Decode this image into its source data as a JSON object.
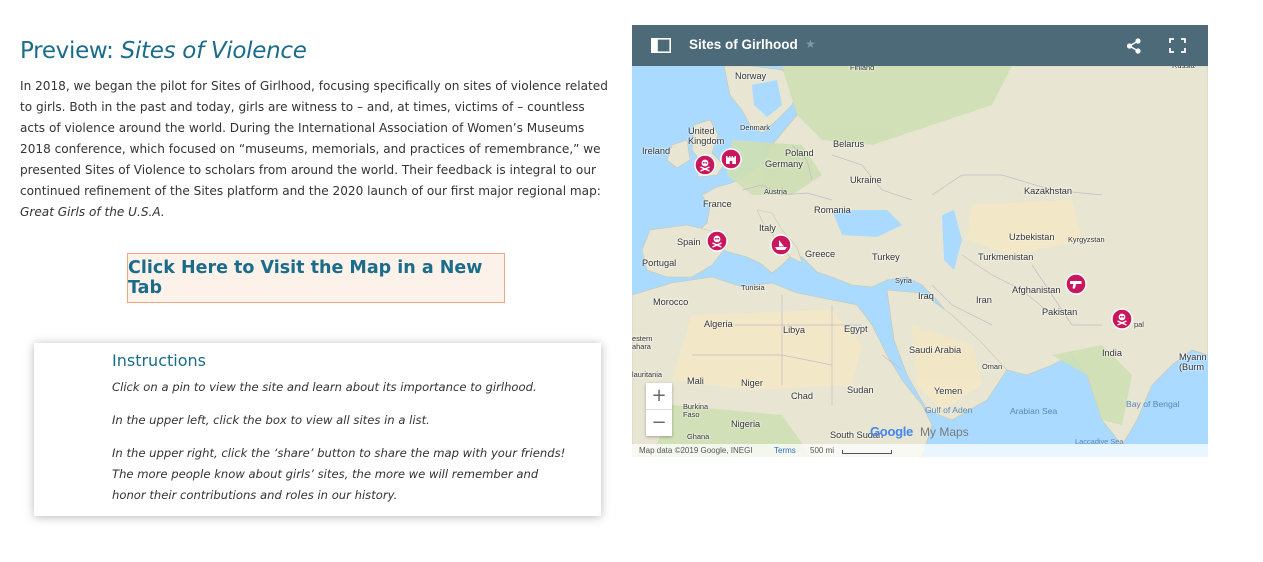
{
  "preview": {
    "title_prefix": "Preview: ",
    "title_em": "Sites of Violence",
    "intro_main": "In 2018, we began the pilot for Sites of Girlhood, focusing specifically on sites of violence related to girls. Both in the past and today, girls are witness to – and, at times, victims of – countless acts of violence around the world. During the International Association of Women’s Museums 2018 conference, which focused on “museums, memorials, and practices of remembrance,” we presented Sites of Violence to scholars from around the world. Their feedback is integral to our continued refinement of the Sites platform and the 2020 launch of our first major regional map: ",
    "intro_em": "Great Girls of the U.S.A."
  },
  "visit_button": "Click Here to Visit the Map in a New Tab",
  "instructions": {
    "heading": "Instructions",
    "items": [
      "Click on a pin to view the site and learn about its importance to girlhood.",
      "In the upper left, click the box to view all sites in a list.",
      "In the upper right, click the ‘share’ button to share the map with your friends! The more people know about girls’ sites, the more we will remember and honor their contributions and roles in our history."
    ]
  },
  "map": {
    "title": "Sites of Girlhood",
    "icons": {
      "list": "sidebar-list-icon",
      "star": "star-icon",
      "share": "share-icon",
      "fullscreen": "fullscreen-icon",
      "pin_colour": "#c8175d",
      "header_colour": "#4d6a78"
    },
    "labels": {
      "finland": "Finland",
      "norway": "Norway",
      "russia": "Russia",
      "uk": "United\nKingdom",
      "denmark": "Denmark",
      "ireland": "Ireland",
      "germany": "Germany",
      "poland": "Poland",
      "belarus": "Belarus",
      "ukraine": "Ukraine",
      "austria": "Austria",
      "france": "France",
      "romania": "Romania",
      "kazakhstan": "Kazakhstan",
      "italy": "Italy",
      "spain": "Spain",
      "portugal": "Portugal",
      "greece": "Greece",
      "turkey": "Turkey",
      "uzbekistan": "Uzbekistan",
      "kyrgyzstan": "Kyrgyzstan",
      "turkmenistan": "Turkmenistan",
      "syria": "Syria",
      "tunisia": "Tunisia",
      "iraq": "Iraq",
      "iran": "Iran",
      "afghanistan": "Afghanistan",
      "morocco": "Morocco",
      "algeria": "Algeria",
      "libya": "Libya",
      "egypt": "Egypt",
      "pakistan": "Pakistan",
      "western_sahara": "estern\nahara",
      "nepal": "pal",
      "saudi": "Saudi Arabia",
      "india": "India",
      "myanmar": "Myann\n(Burm",
      "oman": "Oman",
      "mauritania": "lauritania",
      "mali": "Mali",
      "niger": "Niger",
      "chad": "Chad",
      "sudan": "Sudan",
      "yemen": "Yemen",
      "gulf_aden": "Gulf of Aden",
      "arabian_sea": "Arabian Sea",
      "bay_bengal": "Bay of Bengal",
      "burkina": "Burkina\nFaso",
      "nigeria": "Nigeria",
      "ghana": "Ghana",
      "south_sudan": "South Sudan",
      "laccadive": "Laccadive Sea"
    },
    "pins": [
      {
        "name": "uk-skull-pin",
        "glyph": "☠"
      },
      {
        "name": "germany-castle-pin",
        "glyph": "♜"
      },
      {
        "name": "spain-skull-pin",
        "glyph": "☠"
      },
      {
        "name": "italy-ship-pin",
        "glyph": "⛵"
      },
      {
        "name": "afghanistan-gun-pin",
        "glyph": "🔫"
      },
      {
        "name": "nepal-skull-pin",
        "glyph": "☠"
      }
    ],
    "zoom_in": "+",
    "zoom_out": "−",
    "google": "Google",
    "my_maps": "My Maps",
    "attribution": "Map data ©2019 Google, INEGI",
    "terms": "Terms",
    "scale": "500 mi"
  }
}
